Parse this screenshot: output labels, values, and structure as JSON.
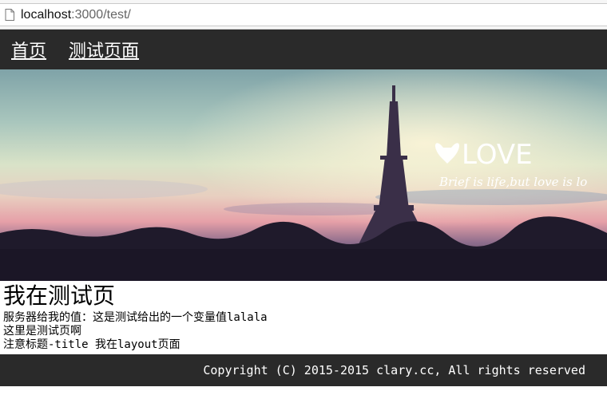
{
  "browser": {
    "url_host": "localhost",
    "url_rest": ":3000/test/"
  },
  "nav": {
    "items": [
      {
        "label": "首页"
      },
      {
        "label": "测试页面"
      }
    ]
  },
  "banner": {
    "love_text": "LOVE",
    "tagline": "Brief is life,but love is lo"
  },
  "content": {
    "title": "我在测试页",
    "lines": [
      "服务器给我的值：这是测试给出的一个变量值lalala",
      "这里是测试页啊",
      "注意标题-title 我在layout页面"
    ]
  },
  "footer": {
    "copyright": "Copyright (C) 2015-2015 clary.cc, All rights reserved"
  }
}
